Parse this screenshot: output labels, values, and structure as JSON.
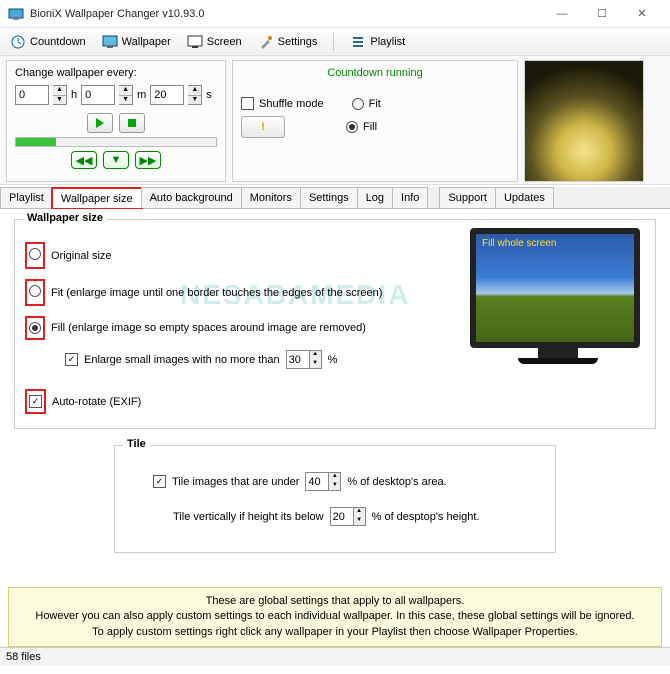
{
  "title": "BioniX Wallpaper Changer v10.93.0",
  "toolbar": {
    "countdown": "Countdown",
    "wallpaper": "Wallpaper",
    "screen": "Screen",
    "settings": "Settings",
    "playlist": "Playlist"
  },
  "interval": {
    "label": "Change wallpaper every:",
    "h": "0",
    "h_unit": "h",
    "m": "0",
    "m_unit": "m",
    "s": "20",
    "s_unit": "s"
  },
  "countdown": {
    "title": "Countdown running",
    "shuffle": "Shuffle mode",
    "fit": "Fit",
    "fill": "Fill"
  },
  "tabs": [
    "Playlist",
    "Wallpaper size",
    "Auto background",
    "Monitors",
    "Settings",
    "Log",
    "Info",
    "Support",
    "Updates"
  ],
  "wallsize": {
    "group": "Wallpaper size",
    "monitor_label": "Fill whole screen",
    "original": "Original size",
    "fit": "Fit (enlarge image until one border touches the edges of the screen)",
    "fill": "Fill (enlarge image so empty spaces around image are removed)",
    "enlarge": "Enlarge small images with no more than",
    "enlarge_val": "30",
    "enlarge_pct": "%",
    "auto_rotate": "Auto-rotate (EXIF)"
  },
  "tile": {
    "group": "Tile",
    "row1a": "Tile images that are under",
    "row1_val": "40",
    "row1b": "% of desktop's area.",
    "row2a": "Tile vertically if height its below",
    "row2_val": "20",
    "row2b": "% of desptop's height."
  },
  "info": {
    "line1": "These are global settings that apply to all wallpapers.",
    "line2": "However you can also apply custom settings to each individual wallpaper. In this case, these global settings will be ignored.",
    "line3": "To apply custom settings right click any wallpaper in your Playlist then choose Wallpaper Properties."
  },
  "status": "58 files",
  "watermark": "NESABAMEDIA"
}
